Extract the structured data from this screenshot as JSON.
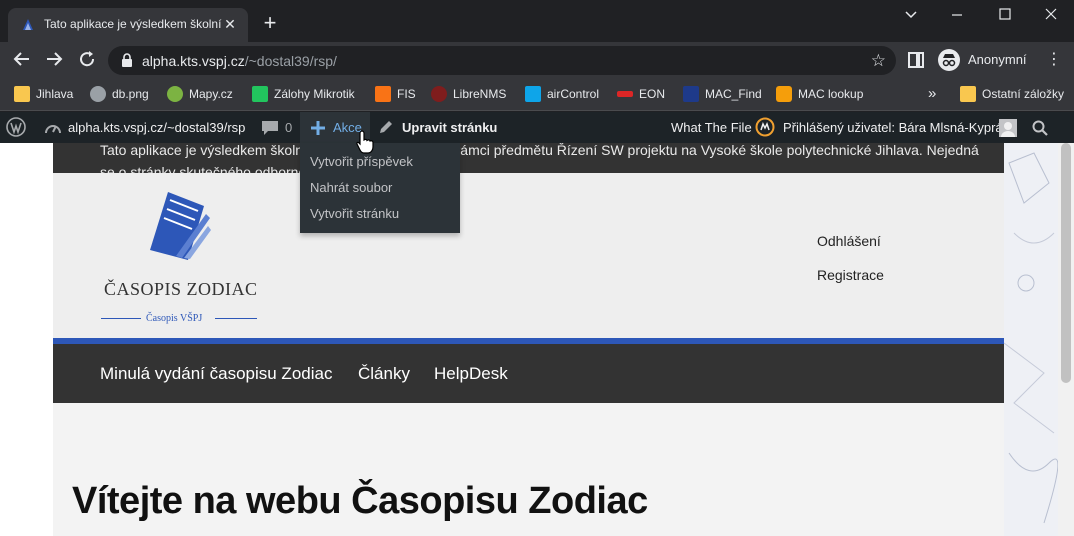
{
  "browser": {
    "tab_title": "Tato aplikace je výsledkem školní",
    "tab_close": "✕",
    "new_tab": "+",
    "window_controls": {
      "minimize": "—",
      "maximize": "☐",
      "close": "✕"
    },
    "url_host": "alpha.kts.vspj.cz",
    "url_path": "/~dostal39/rsp/",
    "profile_label": "Anonymní",
    "icons": [
      "back-icon",
      "forward-icon",
      "reload-icon",
      "lock-icon",
      "star-icon",
      "side-panel-icon",
      "incognito-icon",
      "menu-icon"
    ]
  },
  "bookmarks": {
    "items": [
      {
        "label": "Jihlava",
        "icon": "folder-icon",
        "color": "#f9c74f"
      },
      {
        "label": "db.png",
        "icon": "globe-icon",
        "color": "#9aa0a6"
      },
      {
        "label": "Mapy.cz",
        "icon": "mapy-icon",
        "color": "#7cb342"
      },
      {
        "label": "Zálohy Mikrotik",
        "icon": "z-icon",
        "color": "#22c55e"
      },
      {
        "label": "FIS",
        "icon": "fis-icon",
        "color": "#f97316"
      },
      {
        "label": "LibreNMS",
        "icon": "librenms-icon",
        "color": "#dc2626"
      },
      {
        "label": "airControl",
        "icon": "aircontrol-icon",
        "color": "#0ea5e9"
      },
      {
        "label": "EON",
        "icon": "eon-icon",
        "color": "#dc2626"
      },
      {
        "label": "MAC_Find",
        "icon": "macfind-icon",
        "color": "#1e3a8a"
      },
      {
        "label": "MAC lookup",
        "icon": "maclookup-icon",
        "color": "#f59e0b"
      }
    ],
    "overflow": "»",
    "other_folder": "Ostatní záložky"
  },
  "wp_admin_bar": {
    "site_name": "alpha.kts.vspj.cz/~dostal39/rsp",
    "comments_count": "0",
    "new_label": "Akce",
    "edit_page_label": "Upravit stránku",
    "wtf_label": "What The File",
    "user_label": "Přihlášený uživatel: Bára Mlsná-Kyprá",
    "dropdown": [
      "Vytvořit příspěvek",
      "Nahrát soubor",
      "Vytvořit stránku"
    ],
    "accent": "#72aee6"
  },
  "site": {
    "notice": "Tato aplikace je výsledkem školního týmového projektu v rámci předmětu Řízení SW projektu na Vysoké škole polytechnické Jihlava. Nejedná se o stránky skutečného odborného časopisu.",
    "logo_title": "ČASOPIS ZODIAC",
    "logo_subtitle": "Časopis VŠPJ",
    "header_links": [
      "Odhlášení",
      "Registrace"
    ],
    "nav": [
      "Minulá vydání časopisu Zodiac",
      "Články",
      "HelpDesk"
    ],
    "page_title": "Vítejte na webu Časopisu Zodiac",
    "brand_color": "#2d57b8"
  }
}
